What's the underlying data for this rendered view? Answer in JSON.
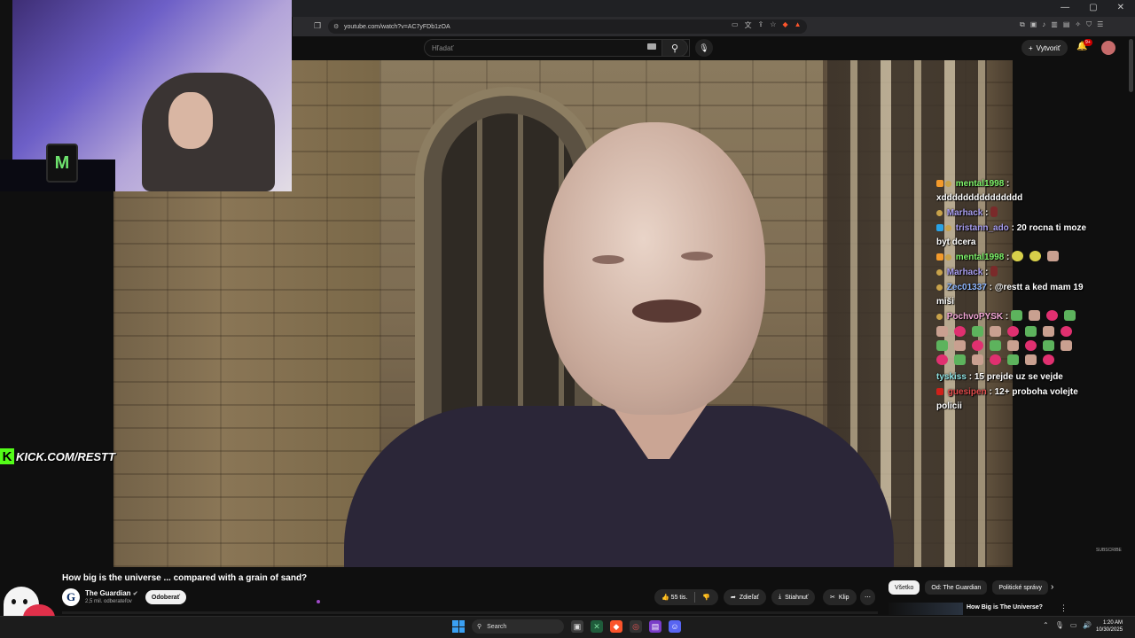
{
  "browser": {
    "url": "youtube.com/watch?v=AC7yFDb1zOA",
    "window_controls": [
      "—",
      "▢",
      "✕"
    ]
  },
  "youtube": {
    "search_placeholder": "Hľadať",
    "create_label": "Vytvoriť",
    "notifications_badge": "9+",
    "video_title": "How big is the universe ... compared with a grain of sand?",
    "channel": {
      "name": "The Guardian",
      "logo_letter": "G",
      "subscribers": "2,5 mil. odberateľov",
      "subscribe_label": "Odoberať"
    },
    "actions": {
      "likes": "55 tis.",
      "share": "Zdieľať",
      "download": "Stiahnuť",
      "clip": "Klip",
      "more": "⋯"
    },
    "filters": [
      "Všetko",
      "Od: The Guardian",
      "Politické správy"
    ],
    "recommendation": {
      "title": "How Big is The Universe?"
    },
    "subscribe_watermark": "SUBSCRIBE"
  },
  "stream": {
    "kick_url": "KICK.COM/RESTT",
    "monster_logo": "M"
  },
  "chat": [
    {
      "user": "mental1998",
      "text": "xddddddddddddddd",
      "badge": "b-orange",
      "color": "u-green"
    },
    {
      "user": "Marhack",
      "text": "",
      "badge": "b-gold",
      "color": "u-purple"
    },
    {
      "user": "tristann_ado",
      "text": "20 rocna ti moze byt dcera",
      "badge": "b-blue",
      "color": "u-purple"
    },
    {
      "user": "mental1998",
      "text": "",
      "badge": "b-orange",
      "color": "u-green"
    },
    {
      "user": "Marhack",
      "text": "",
      "badge": "b-gold",
      "color": "u-purple"
    },
    {
      "user": "Zec01337",
      "text": "@restt a ked mam 19 miši",
      "badge": "b-gold",
      "color": "u-blue"
    },
    {
      "user": "PochvoPYSK",
      "text": "",
      "badge": "b-gold",
      "color": "u-pink"
    },
    {
      "user": "tyskiss",
      "text": "15 prejde uz se vejde",
      "badge": "",
      "color": "u-cyan"
    },
    {
      "user": "guesipen",
      "text": "12+ proboha volejte policii",
      "badge": "b-red",
      "color": "u-red"
    }
  ],
  "taskbar": {
    "search_label": "Search",
    "time": "1:20 AM",
    "date": "10/30/2025"
  }
}
